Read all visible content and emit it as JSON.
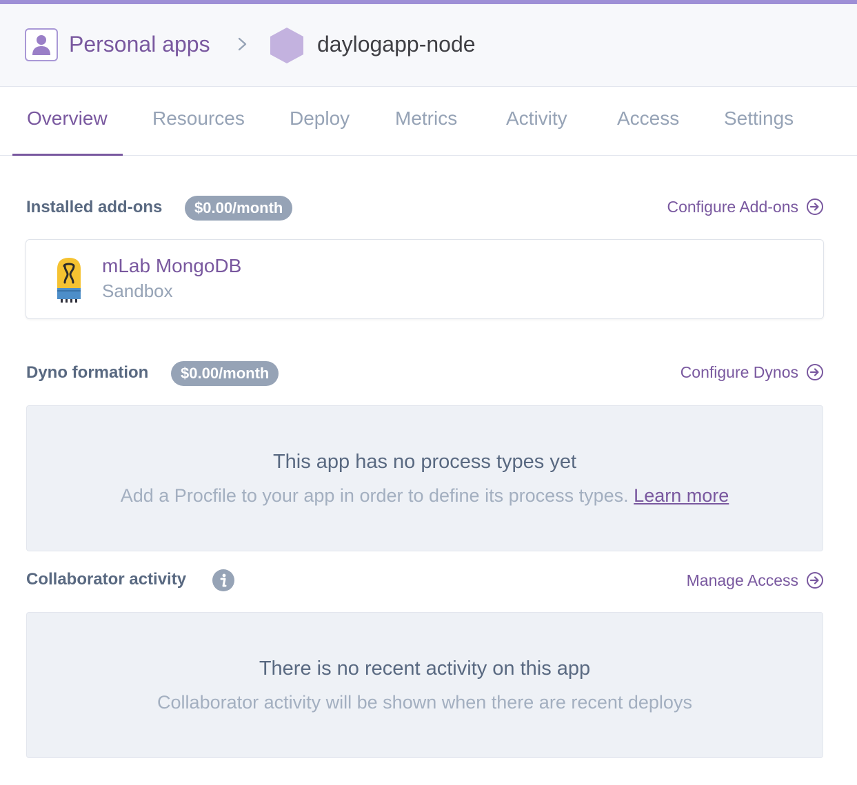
{
  "header": {
    "breadcrumb": {
      "root_label": "Personal apps",
      "separator": ">",
      "app_name": "daylogapp-node"
    }
  },
  "tabs": [
    {
      "label": "Overview",
      "active": true
    },
    {
      "label": "Resources",
      "active": false
    },
    {
      "label": "Deploy",
      "active": false
    },
    {
      "label": "Metrics",
      "active": false
    },
    {
      "label": "Activity",
      "active": false
    },
    {
      "label": "Access",
      "active": false
    },
    {
      "label": "Settings",
      "active": false
    }
  ],
  "addons": {
    "title": "Installed add-ons",
    "price": "$0.00/month",
    "link_label": "Configure Add-ons",
    "items": [
      {
        "name": "mLab MongoDB",
        "plan": "Sandbox",
        "icon": "mlab-logo"
      }
    ]
  },
  "dynos": {
    "title": "Dyno formation",
    "price": "$0.00/month",
    "link_label": "Configure Dynos",
    "empty_title": "This app has no process types yet",
    "empty_text": "Add a Procfile to your app in order to define its process types.",
    "learn_more": "Learn more"
  },
  "collaborators": {
    "title": "Collaborator activity",
    "link_label": "Manage Access",
    "empty_title": "There is no recent activity on this app",
    "empty_text": "Collaborator activity will be shown when there are recent deploys"
  },
  "colors": {
    "accent": "#79589f",
    "muted": "#96a3b6",
    "panel": "#eef1f6",
    "top_strip": "#9e8fd6"
  }
}
